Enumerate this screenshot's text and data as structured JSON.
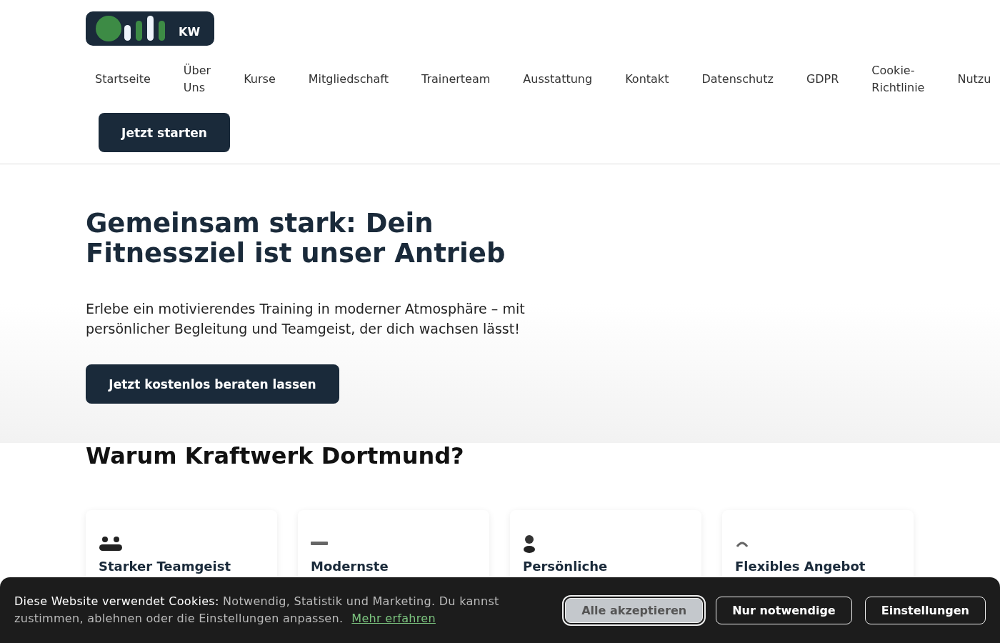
{
  "header": {
    "logo": {
      "text": "KW"
    },
    "nav": [
      "Startseite",
      "Über Uns",
      "Kurse",
      "Mitgliedschaft",
      "Trainerteam",
      "Ausstattung",
      "Kontakt",
      "Datenschutz",
      "GDPR",
      "Cookie-Richtlinie",
      "Nutzu"
    ],
    "cta": "Jetzt starten"
  },
  "hero": {
    "title": "Gemeinsam stark: Dein Fitnessziel ist unser Antrieb",
    "text": "Erlebe ein motivierendes Training in moderner Atmosphäre – mit persönlicher Begleitung und Teamgeist, der dich wachsen lässt!",
    "button": "Jetzt kostenlos beraten lassen"
  },
  "features": {
    "title": "Warum Kraftwerk Dortmund?",
    "cards": [
      {
        "kind": "team",
        "title": "Starker Teamgeist"
      },
      {
        "kind": "equipment",
        "title": "Modernste"
      },
      {
        "kind": "person",
        "title": "Persönliche"
      },
      {
        "kind": "flex",
        "title": "Flexibles Angebot"
      }
    ]
  },
  "cookie_banner": {
    "lead": "Diese Website verwendet Cookies:",
    "text": "Notwendig, Statistik und Marketing. Du kannst zustimmen, ablehnen oder die Einstellungen anpassen.",
    "link": "Mehr erfahren",
    "buttons": [
      {
        "label": "Alle akzeptieren",
        "selected": true
      },
      {
        "label": "Nur notwendige",
        "selected": false
      },
      {
        "label": "Einstellungen",
        "selected": false
      }
    ]
  }
}
